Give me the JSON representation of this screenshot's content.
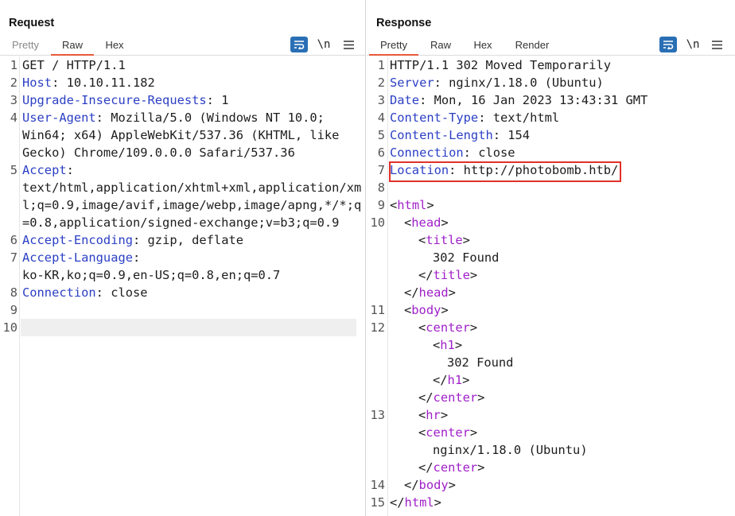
{
  "request": {
    "title": "Request",
    "tabs": [
      "Pretty",
      "Raw",
      "Hex"
    ],
    "active_tab": "Raw",
    "newline_toggle": "\\n",
    "lines": [
      {
        "n": "1",
        "parts": [
          [
            "t",
            "GET / HTTP/1.1"
          ]
        ]
      },
      {
        "n": "2",
        "parts": [
          [
            "h",
            "Host"
          ],
          [
            "t",
            ": 10.10.11.182"
          ]
        ]
      },
      {
        "n": "3",
        "parts": [
          [
            "h",
            "Upgrade-Insecure-Requests"
          ],
          [
            "t",
            ": 1"
          ]
        ]
      },
      {
        "n": "4",
        "parts": [
          [
            "h",
            "User-Agent"
          ],
          [
            "t",
            ": Mozilla/5.0 (Windows NT 10.0;"
          ]
        ]
      },
      {
        "n": "",
        "parts": [
          [
            "t",
            "Win64; x64) AppleWebKit/537.36 (KHTML, like"
          ]
        ]
      },
      {
        "n": "",
        "parts": [
          [
            "t",
            "Gecko) Chrome/109.0.0.0 Safari/537.36"
          ]
        ]
      },
      {
        "n": "5",
        "parts": [
          [
            "h",
            "Accept"
          ],
          [
            "t",
            ":"
          ]
        ]
      },
      {
        "n": "",
        "parts": [
          [
            "t",
            "text/html,application/xhtml+xml,application/xm"
          ]
        ]
      },
      {
        "n": "",
        "parts": [
          [
            "t",
            "l;q=0.9,image/avif,image/webp,image/apng,*/*;q"
          ]
        ]
      },
      {
        "n": "",
        "parts": [
          [
            "t",
            "=0.8,application/signed-exchange;v=b3;q=0.9"
          ]
        ]
      },
      {
        "n": "6",
        "parts": [
          [
            "h",
            "Accept-Encoding"
          ],
          [
            "t",
            ": gzip, deflate"
          ]
        ]
      },
      {
        "n": "7",
        "parts": [
          [
            "h",
            "Accept-Language"
          ],
          [
            "t",
            ":"
          ]
        ]
      },
      {
        "n": "",
        "parts": [
          [
            "t",
            "ko-KR,ko;q=0.9,en-US;q=0.8,en;q=0.7"
          ]
        ]
      },
      {
        "n": "8",
        "parts": [
          [
            "h",
            "Connection"
          ],
          [
            "t",
            ": close"
          ]
        ]
      },
      {
        "n": "9",
        "parts": []
      },
      {
        "n": "10",
        "parts": []
      }
    ]
  },
  "response": {
    "title": "Response",
    "tabs": [
      "Pretty",
      "Raw",
      "Hex",
      "Render"
    ],
    "active_tab": "Pretty",
    "newline_toggle": "\\n",
    "lines": [
      {
        "n": "1",
        "indent": 0,
        "parts": [
          [
            "t",
            "HTTP/1.1 302 Moved Temporarily"
          ]
        ]
      },
      {
        "n": "2",
        "indent": 0,
        "parts": [
          [
            "h",
            "Server"
          ],
          [
            "t",
            ": nginx/1.18.0 (Ubuntu)"
          ]
        ]
      },
      {
        "n": "3",
        "indent": 0,
        "parts": [
          [
            "h",
            "Date"
          ],
          [
            "t",
            ": Mon, 16 Jan 2023 13:43:31 GMT"
          ]
        ]
      },
      {
        "n": "4",
        "indent": 0,
        "parts": [
          [
            "h",
            "Content-Type"
          ],
          [
            "t",
            ": text/html"
          ]
        ]
      },
      {
        "n": "5",
        "indent": 0,
        "parts": [
          [
            "h",
            "Content-Length"
          ],
          [
            "t",
            ": 154"
          ]
        ]
      },
      {
        "n": "6",
        "indent": 0,
        "parts": [
          [
            "h",
            "Connection"
          ],
          [
            "t",
            ": close"
          ]
        ]
      },
      {
        "n": "7",
        "indent": 0,
        "parts": [
          [
            "h",
            "Location"
          ],
          [
            "t",
            ": http://photobomb.htb/"
          ]
        ]
      },
      {
        "n": "8",
        "indent": 0,
        "parts": []
      },
      {
        "n": "9",
        "indent": 0,
        "parts": [
          [
            "t",
            "<"
          ],
          [
            "g",
            "html"
          ],
          [
            "t",
            ">"
          ]
        ]
      },
      {
        "n": "10",
        "indent": 1,
        "parts": [
          [
            "t",
            "<"
          ],
          [
            "g",
            "head"
          ],
          [
            "t",
            ">"
          ]
        ]
      },
      {
        "n": "",
        "indent": 2,
        "parts": [
          [
            "t",
            "<"
          ],
          [
            "g",
            "title"
          ],
          [
            "t",
            ">"
          ]
        ]
      },
      {
        "n": "",
        "indent": 3,
        "parts": [
          [
            "t",
            "302 Found"
          ]
        ]
      },
      {
        "n": "",
        "indent": 2,
        "parts": [
          [
            "t",
            "</"
          ],
          [
            "g",
            "title"
          ],
          [
            "t",
            ">"
          ]
        ]
      },
      {
        "n": "",
        "indent": 1,
        "parts": [
          [
            "t",
            "</"
          ],
          [
            "g",
            "head"
          ],
          [
            "t",
            ">"
          ]
        ]
      },
      {
        "n": "11",
        "indent": 1,
        "parts": [
          [
            "t",
            "<"
          ],
          [
            "g",
            "body"
          ],
          [
            "t",
            ">"
          ]
        ]
      },
      {
        "n": "12",
        "indent": 2,
        "parts": [
          [
            "t",
            "<"
          ],
          [
            "g",
            "center"
          ],
          [
            "t",
            ">"
          ]
        ]
      },
      {
        "n": "",
        "indent": 3,
        "parts": [
          [
            "t",
            "<"
          ],
          [
            "g",
            "h1"
          ],
          [
            "t",
            ">"
          ]
        ]
      },
      {
        "n": "",
        "indent": 4,
        "parts": [
          [
            "t",
            "302 Found"
          ]
        ]
      },
      {
        "n": "",
        "indent": 3,
        "parts": [
          [
            "t",
            "</"
          ],
          [
            "g",
            "h1"
          ],
          [
            "t",
            ">"
          ]
        ]
      },
      {
        "n": "",
        "indent": 2,
        "parts": [
          [
            "t",
            "</"
          ],
          [
            "g",
            "center"
          ],
          [
            "t",
            ">"
          ]
        ]
      },
      {
        "n": "13",
        "indent": 2,
        "parts": [
          [
            "t",
            "<"
          ],
          [
            "g",
            "hr"
          ],
          [
            "t",
            ">"
          ]
        ]
      },
      {
        "n": "",
        "indent": 2,
        "parts": [
          [
            "t",
            "<"
          ],
          [
            "g",
            "center"
          ],
          [
            "t",
            ">"
          ]
        ]
      },
      {
        "n": "",
        "indent": 3,
        "parts": [
          [
            "t",
            "nginx/1.18.0 (Ubuntu)"
          ]
        ]
      },
      {
        "n": "",
        "indent": 2,
        "parts": [
          [
            "t",
            "</"
          ],
          [
            "g",
            "center"
          ],
          [
            "t",
            ">"
          ]
        ]
      },
      {
        "n": "14",
        "indent": 1,
        "parts": [
          [
            "t",
            "</"
          ],
          [
            "g",
            "body"
          ],
          [
            "t",
            ">"
          ]
        ]
      },
      {
        "n": "15",
        "indent": 0,
        "parts": [
          [
            "t",
            "</"
          ],
          [
            "g",
            "html"
          ],
          [
            "t",
            ">"
          ]
        ]
      }
    ]
  },
  "colors": {
    "accent": "#2a6fb5",
    "tab_underline": "#e8593a",
    "header_name": "#2b3fc4",
    "html_tag": "#a020c8",
    "highlight_box": "#e0312a"
  },
  "icons": {
    "wrap": "word-wrap-icon",
    "menu": "hamburger-menu-icon",
    "layout": [
      "side-by-side-layout-icon",
      "top-bottom-layout-icon",
      "single-pane-layout-icon"
    ]
  }
}
